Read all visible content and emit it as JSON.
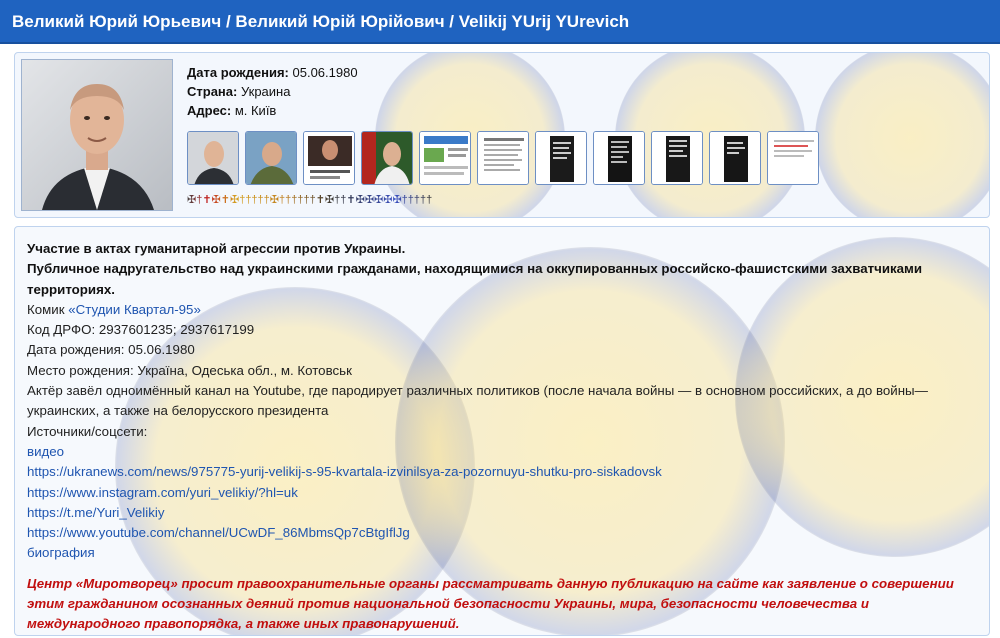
{
  "header": {
    "title": "Великий Юрий Юрьевич / Великий Юрій Юрійович / Velikij YUrij YUrevich"
  },
  "profile": {
    "birth_label": "Дата рождения:",
    "birth_value": "05.06.1980",
    "country_label": "Страна:",
    "country_value": "Украина",
    "address_label": "Адрес:",
    "address_value": "м. Київ",
    "crosses": "✠†✝✠✝✠†††††✠††††††✝✠††✝✠✠✠✠✠†††††"
  },
  "content": {
    "heading1": "Участие в актах гуманитарной агрессии против Украины.",
    "heading2": "Публичное надругательство над украинскими гражданами, находящимися на оккупированных российско-фашистскими захватчиками территориях.",
    "comic_prefix": "Комик",
    "comic_link": "«Студии Квартал-95»",
    "drfo": "Код ДРФО: 2937601235; 2937617199",
    "birth": "Дата рождения: 05.06.1980",
    "birthplace": "Место рождения: Україна, Одеська обл., м. Котовськ",
    "bio": "Актёр завёл одноимённый канал на Youtube, где пародирует различных политиков (после начала войны — в основном российских, а до войны— украинских, а также на белорусского президента",
    "sources_label": "Источники/соцсети:",
    "links": [
      "видео",
      "https://ukranews.com/news/975775-yurij-velikij-s-95-kvartala-izvinilsya-za-pozornuyu-shutku-pro-siskadovsk",
      "https://www.instagram.com/yuri_velikiy/?hl=uk",
      "https://t.me/Yuri_Velikiy",
      "https://www.youtube.com/channel/UCwDF_86MbmsQp7cBtgIflJg",
      "биография"
    ],
    "warning": "Центр «Миротворец» просит правоохранительные органы рассматривать данную публикацию на сайте как заявление о совершении этим гражданином осознанных деяний против национальной безопасности Украины, мира, безопасности человечества и международного правопорядка, а также иных правонарушений."
  },
  "colors": {
    "header_bg": "#1f63c0",
    "link": "#1f55b0",
    "warning": "#c10f0f"
  }
}
